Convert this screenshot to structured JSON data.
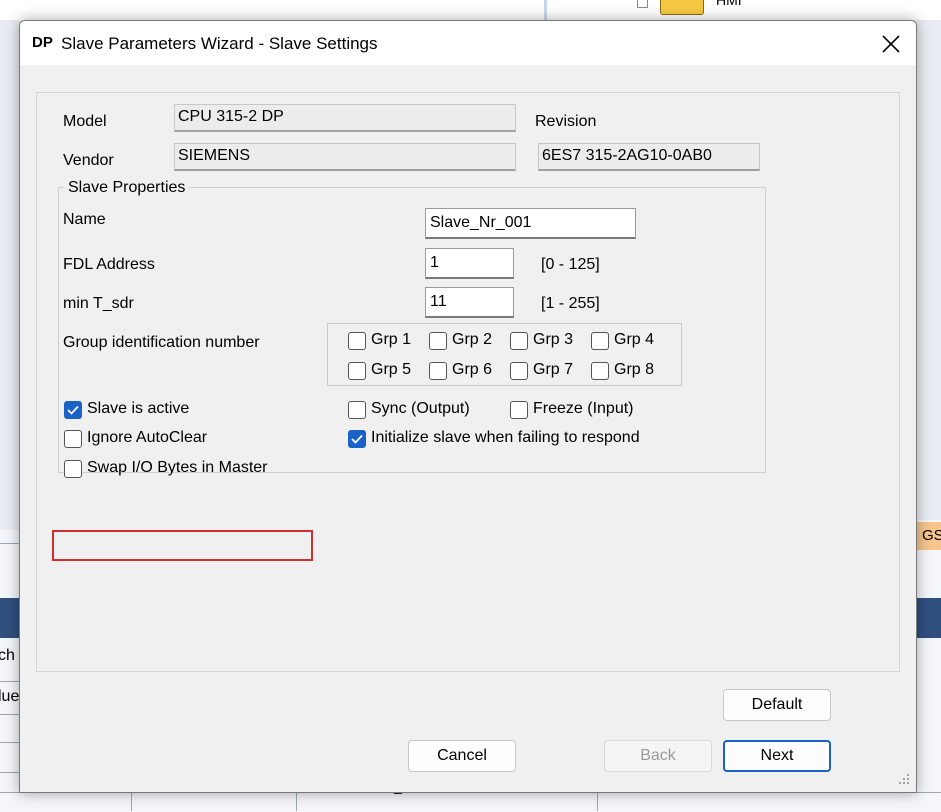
{
  "dialog": {
    "icon_text": "DP",
    "title": "Slave Parameters Wizard - Slave Settings"
  },
  "background": {
    "folder_label": "HMI",
    "right_tab": "GS",
    "left_text_1": "ch",
    "left_text_2": "lue",
    "left_text_3": "_"
  },
  "device": {
    "model_label": "Model",
    "model_value": "CPU 315-2 DP",
    "vendor_label": "Vendor",
    "vendor_value": "SIEMENS",
    "revision_label": "Revision",
    "revision_value": "6ES7 315-2AG10-0AB0"
  },
  "slave_properties": {
    "title": "Slave Properties",
    "name_label": "Name",
    "name_value": "Slave_Nr_001",
    "fdl_label": "FDL Address",
    "fdl_value": "1",
    "fdl_range": "[0 - 125]",
    "tsdr_label": "min T_sdr",
    "tsdr_value": "11",
    "tsdr_range": "[1 - 255]",
    "group_label": "Group identification number",
    "groups": [
      {
        "label": "Grp 1",
        "checked": false
      },
      {
        "label": "Grp 2",
        "checked": false
      },
      {
        "label": "Grp 3",
        "checked": false
      },
      {
        "label": "Grp 4",
        "checked": false
      },
      {
        "label": "Grp 5",
        "checked": false
      },
      {
        "label": "Grp 6",
        "checked": false
      },
      {
        "label": "Grp 7",
        "checked": false
      },
      {
        "label": "Grp 8",
        "checked": false
      }
    ],
    "options": {
      "slave_active": {
        "label": "Slave is active",
        "checked": true
      },
      "sync_output": {
        "label": "Sync (Output)",
        "checked": false
      },
      "freeze_input": {
        "label": "Freeze (Input)",
        "checked": false
      },
      "ignore_autoclear": {
        "label": "Ignore AutoClear",
        "checked": false
      },
      "init_slave": {
        "label": "Initialize slave when failing to respond",
        "checked": true
      },
      "swap_io": {
        "label": "Swap I/O Bytes in Master",
        "checked": false
      }
    }
  },
  "buttons": {
    "default": "Default",
    "cancel": "Cancel",
    "back": "Back",
    "next": "Next"
  },
  "colors": {
    "accent": "#1a62c7",
    "highlight": "#d32f2f"
  }
}
